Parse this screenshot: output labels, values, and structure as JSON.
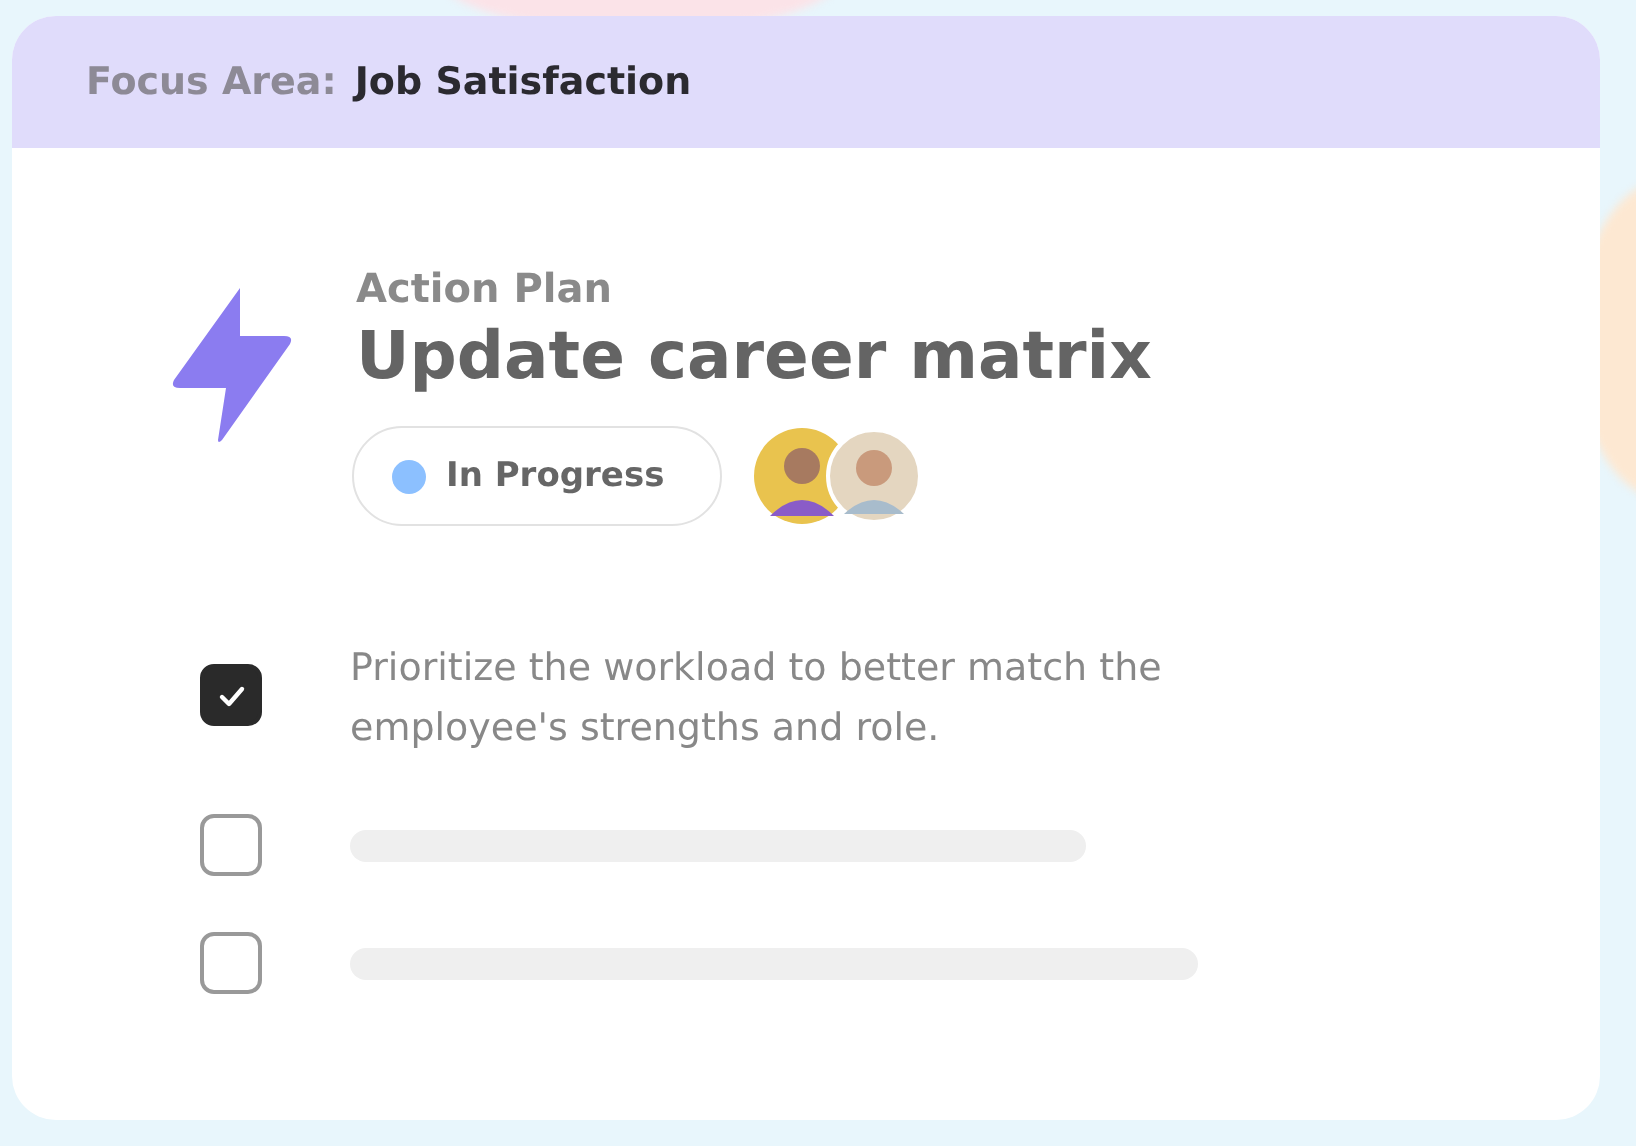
{
  "header": {
    "label": "Focus Area:",
    "value": "Job Satisfaction"
  },
  "plan": {
    "eyebrow": "Action Plan",
    "title": "Update career matrix"
  },
  "status": {
    "label": "In Progress",
    "color": "#8cc0ff"
  },
  "tasks": [
    {
      "kind": "text",
      "text": "Prioritize the workload to better match the employee's strengths and role.",
      "checked": true
    },
    {
      "kind": "skeleton",
      "checked": false
    },
    {
      "kind": "skeleton",
      "checked": false
    }
  ]
}
